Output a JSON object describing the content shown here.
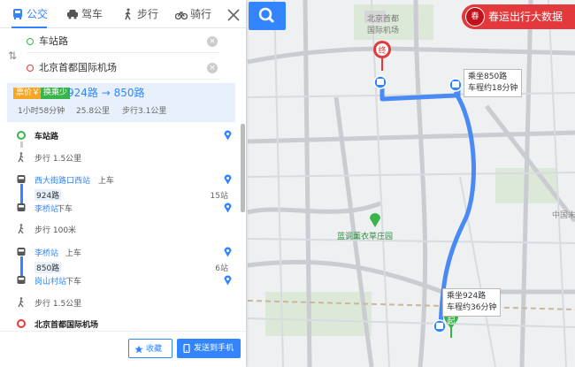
{
  "modes": [
    {
      "label": "公交",
      "icon": "bus-icon"
    },
    {
      "label": "驾车",
      "icon": "car-icon"
    },
    {
      "label": "步行",
      "icon": "walk-icon"
    },
    {
      "label": "骑行",
      "icon": "bike-icon"
    }
  ],
  "route_input": {
    "start": "车站路",
    "end": "北京首都国际机场"
  },
  "route_summary": {
    "tag_cheap": "票价￥6",
    "tag_long": "换乘少",
    "lines": "924路 → 850路",
    "duration": "1小时58分钟",
    "distance": "25.8公里",
    "walk": "步行3.1公里"
  },
  "steps": {
    "start_name": "车站路",
    "walk1": "步行  1.5公里",
    "board1_station": "西大街路口西站",
    "board1_action": "上车",
    "line1": "924路",
    "line1_stops": "15站",
    "alight1_station": "李桥站",
    "alight1_action": "下车",
    "walk2": "步行  100米",
    "board2_station": "李桥站",
    "board2_action": "上车",
    "line2": "850路",
    "line2_stops": "6站",
    "alight2_station": "岗山村站",
    "alight2_action": "下车",
    "walk3": "步行  1.5公里",
    "end_name": "北京首都国际机场"
  },
  "footer": {
    "favorite": "收藏",
    "send": "发送到手机"
  },
  "map": {
    "banner": "春运出行大数据",
    "banner_knot": "春",
    "callout_850_l1": "乘坐850路",
    "callout_850_l2": "车程约18分钟",
    "callout_924_l1": "乘坐924路",
    "callout_924_l2": "车程约36分钟",
    "poi_lavender": "蓝调薰衣草庄园",
    "poi_airport_l1": "北京首都",
    "poi_airport_l2": "国际机场",
    "label_china": "中国末",
    "end_marker": "终",
    "start_marker": "起"
  },
  "colors": {
    "accent": "#3385ff",
    "route": "#4a8af4",
    "start_green": "#3ab54a",
    "end_red": "#e4393c"
  }
}
